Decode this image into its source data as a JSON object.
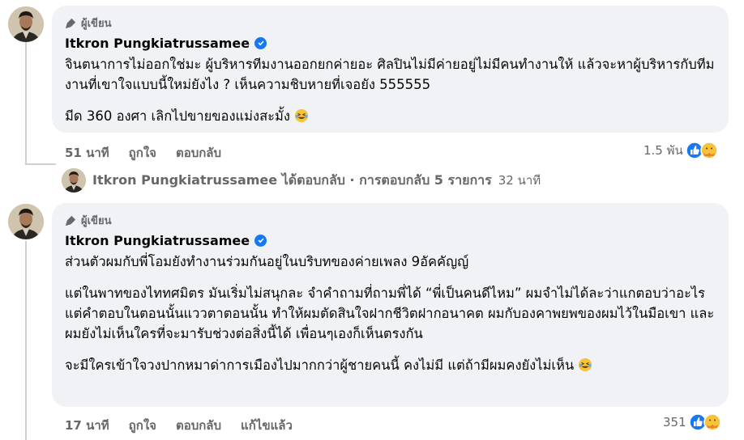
{
  "comment1": {
    "badge": "ผู้เขียน",
    "author": "Itkron Pungkiatrussamee",
    "paragraphs": [
      "จินตนาการไม่ออกใช่มะ ผู้บริหารทีมงานออกยกค่ายอะ ศิลปินไม่มีค่ายอยู่ไม่มีคนทำงานให้ แล้วจะหาผู้บริหารกับทีมงานที่เขาใจแบบนี้ใหม่ยังไง ? เห็นความชิบหายที่เจอยัง 555555",
      "มีด 360 องศา เลิกไปขายของแม่งสะมั้ง"
    ],
    "time": "51 นาที",
    "like": "ถูกใจ",
    "reply": "ตอบกลับ",
    "reaction_count": "1.5 พัน"
  },
  "reply_summary": {
    "author": "Itkron Pungkiatrussamee",
    "text": "ได้ตอบกลับ · การตอบกลับ 5 รายการ",
    "time": "32 นาที"
  },
  "comment2": {
    "badge": "ผู้เขียน",
    "author": "Itkron Pungkiatrussamee",
    "paragraphs": [
      "ส่วนตัวผมกับพี่โอมยังทำงานร่วมกันอยู่ในบริบทของค่ายเพลง 9อัคคัญญ์",
      "แต่ในพาทของไททศมิตร มันเริ่มไม่สนุกละ จำคำถามที่ถามพี่ได้ “พี่เป็นคนดีไหม” ผมจำไม่ได้ละว่าแกตอบว่าอะไร แต่คำตอบในตอนนั้นแววตาตอนนั้น ทำให้ผมตัดสินใจฝากชีวิตฝากอนาคต ผมกับองคาพยพของผมไว้ในมือเขา และผมยังไม่เห็นใครที่จะมารับช่วงต่อสิ่งนี้ได้ เพื่อนๆเองก็เห็นตรงกัน",
      "จะมีใครเข้าใจวงปากหมาด่าการเมืองไปมากกว่าผู้ชายคนนี้ คงไม่มี แต่ถ้ามีผมคงยังไม่เห็น"
    ],
    "time": "17 นาที",
    "like": "ถูกใจ",
    "reply": "ตอบกลับ",
    "edited": "แก้ไขแล้ว",
    "reaction_count": "351"
  },
  "colors": {
    "bubble": "#f0f2f5",
    "secondary_text": "#65676b",
    "verified": "#1877f2"
  }
}
